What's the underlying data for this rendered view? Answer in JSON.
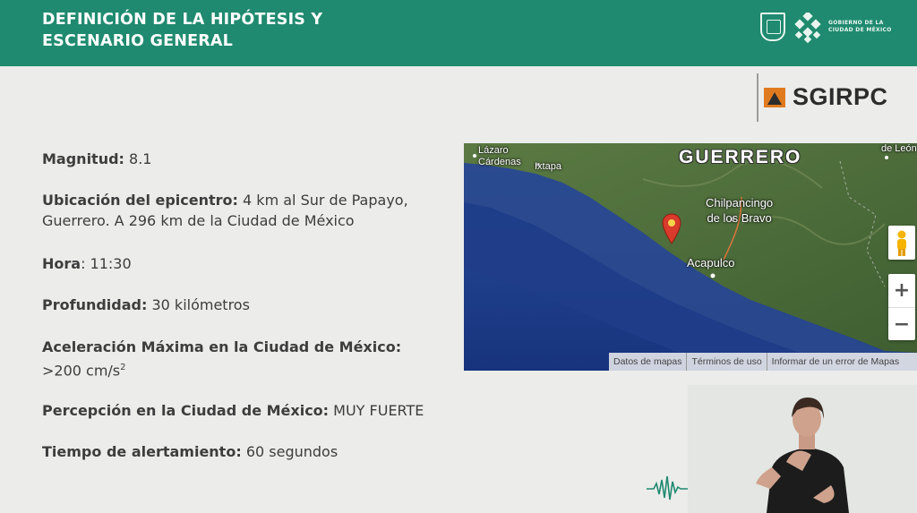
{
  "header": {
    "title_line1": "DEFINICIÓN DE LA HIPÓTESIS Y",
    "title_line2": "ESCENARIO GENERAL",
    "background_color": "#1f8a6f",
    "gov_logo_line1": "GOBIERNO DE LA",
    "gov_logo_line2": "CIUDAD DE MÉXICO"
  },
  "brand": {
    "name": "SGIRPC",
    "accent_color": "#e07a1f"
  },
  "scenario": [
    {
      "label": "Magnitud:",
      "value": "8.1"
    },
    {
      "label": "Ubicación del epicentro:",
      "value": "4 km al Sur de Papayo, Guerrero. A 296 km de la Ciudad de México"
    },
    {
      "label": "Hora",
      "value": ": 11:30"
    },
    {
      "label": "Profundidad:",
      "value": "30 kilómetros"
    },
    {
      "label": "Aceleración Máxima en la Ciudad de México:",
      "value": ">200 cm/s",
      "unit_sup": "2"
    },
    {
      "label": "Percepción en la Ciudad de México:",
      "value": "MUY FUERTE"
    },
    {
      "label": "Tiempo de alertamiento:",
      "value": "60 segundos"
    }
  ],
  "map": {
    "state_label": "GUERRERO",
    "places": {
      "lazaro": "Lázaro",
      "cardenas": "Cárdenas",
      "ixtapa": "Ixtapa",
      "chilpancingo1": "Chilpancingo",
      "chilpancingo2": "de los Bravo",
      "acapulco": "Acapulco",
      "leon": "de León"
    },
    "zoom_in": "+",
    "zoom_out": "−",
    "footer": [
      "Datos de mapas",
      "Términos de uso",
      "Informar de un error de Mapas"
    ],
    "marker_color": "#d93a2b",
    "ocean_color": "#1d3e8f",
    "land_color": "#4f6e3a"
  },
  "icons": {
    "pegman": "pegman-icon",
    "marker": "map-marker-icon",
    "seismic_wave": "seismic-wave-icon"
  }
}
